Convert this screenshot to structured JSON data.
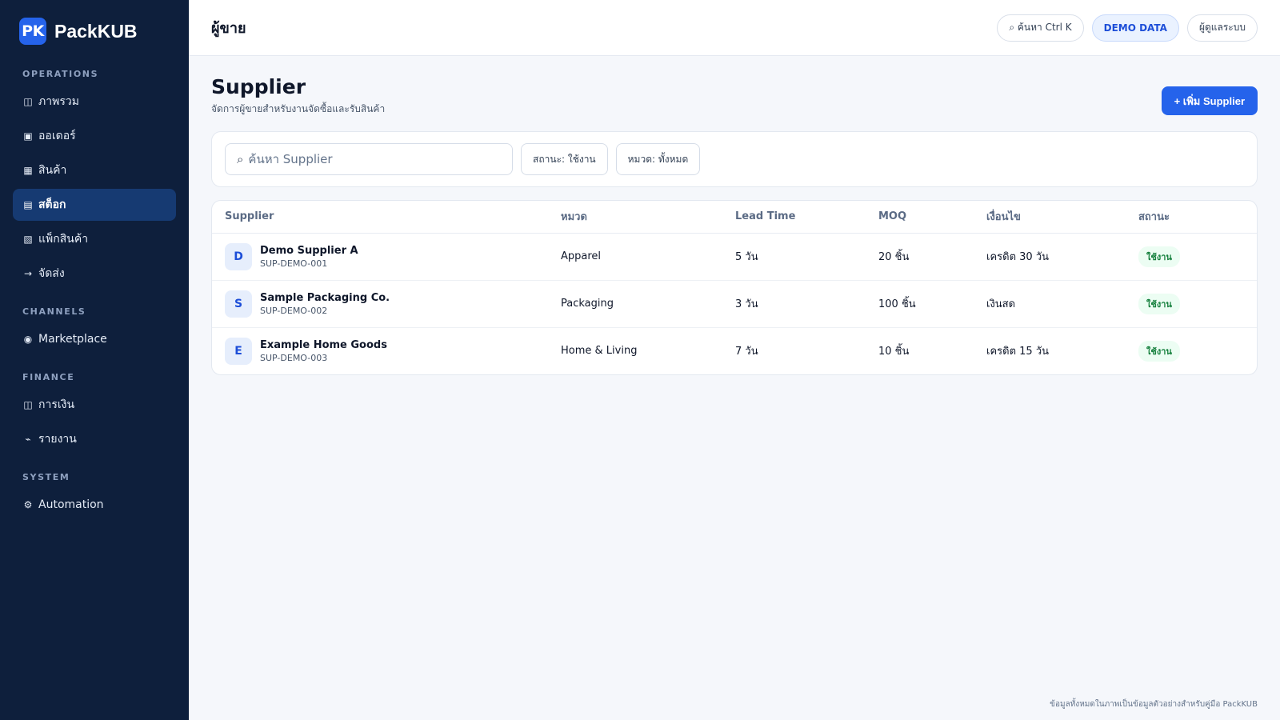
{
  "brand": {
    "badge": "PK",
    "name": "PackKUB",
    "accent": "#2563eb"
  },
  "sidebar": {
    "sections": [
      {
        "title": "OPERATIONS",
        "items": [
          {
            "icon": "◫",
            "label": "ภาพรวม",
            "active": false
          },
          {
            "icon": "▣",
            "label": "ออเดอร์",
            "active": false
          },
          {
            "icon": "▦",
            "label": "สินค้า",
            "active": false
          },
          {
            "icon": "▤",
            "label": "สต็อก",
            "active": true
          },
          {
            "icon": "▧",
            "label": "แพ็กสินค้า",
            "active": false
          },
          {
            "icon": "→",
            "label": "จัดส่ง",
            "active": false
          }
        ]
      },
      {
        "title": "CHANNELS",
        "items": [
          {
            "icon": "◉",
            "label": "Marketplace",
            "active": false
          }
        ]
      },
      {
        "title": "FINANCE",
        "items": [
          {
            "icon": "◫",
            "label": "การเงิน",
            "active": false
          },
          {
            "icon": "⌁",
            "label": "รายงาน",
            "active": false
          }
        ]
      },
      {
        "title": "SYSTEM",
        "items": [
          {
            "icon": "⚙",
            "label": "Automation",
            "active": false
          }
        ]
      }
    ]
  },
  "topbar": {
    "title": "ผู้ขาย",
    "search_label": "⌕ ค้นหา Ctrl K",
    "demo_label": "DEMO DATA",
    "admin_label": "ผู้ดูแลระบบ"
  },
  "page": {
    "title": "Supplier",
    "subtitle": "จัดการผู้ขายสำหรับงานจัดซื้อและรับสินค้า",
    "add_button": "+ เพิ่ม Supplier"
  },
  "filters": {
    "search_placeholder": "ค้นหา Supplier",
    "status": "สถานะ: ใช้งาน",
    "category": "หมวด: ทั้งหมด"
  },
  "table": {
    "headers": [
      "Supplier",
      "หมวด",
      "Lead Time",
      "MOQ",
      "เงื่อนไข",
      "สถานะ"
    ],
    "rows": [
      {
        "initial": "D",
        "name": "Demo Supplier A",
        "code": "SUP-DEMO-001",
        "category": "Apparel",
        "lead_time": "5 วัน",
        "moq": "20 ชิ้น",
        "terms": "เครดิต 30 วัน",
        "status": "ใช้งาน"
      },
      {
        "initial": "S",
        "name": "Sample Packaging Co.",
        "code": "SUP-DEMO-002",
        "category": "Packaging",
        "lead_time": "3 วัน",
        "moq": "100 ชิ้น",
        "terms": "เงินสด",
        "status": "ใช้งาน"
      },
      {
        "initial": "E",
        "name": "Example Home Goods",
        "code": "SUP-DEMO-003",
        "category": "Home & Living",
        "lead_time": "7 วัน",
        "moq": "10 ชิ้น",
        "terms": "เครดิต 15 วัน",
        "status": "ใช้งาน"
      }
    ]
  },
  "footnote": "ข้อมูลทั้งหมดในภาพเป็นข้อมูลตัวอย่างสำหรับคู่มือ PackKUB"
}
